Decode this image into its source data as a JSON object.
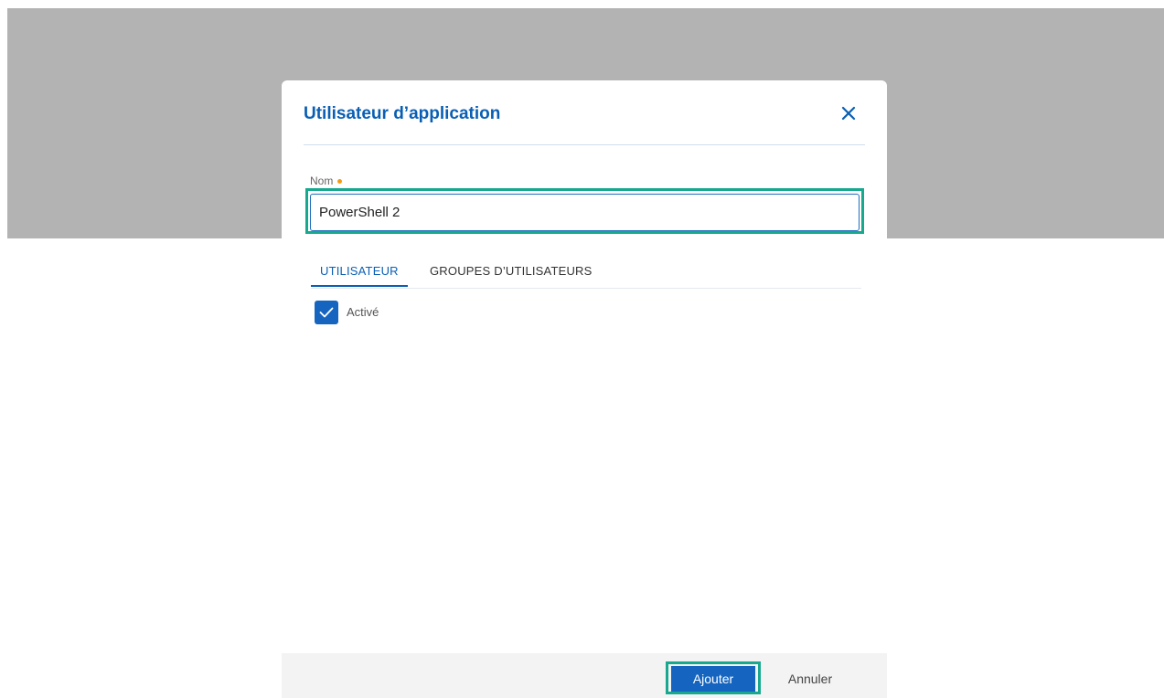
{
  "dialog": {
    "title": "Utilisateur d’application",
    "close_icon": "close-icon"
  },
  "form": {
    "name_label": "Nom",
    "name_value": "PowerShell 2"
  },
  "tabs": [
    {
      "label": "UTILISATEUR",
      "active": true
    },
    {
      "label": "GROUPES D’UTILISATEURS",
      "active": false
    }
  ],
  "user_tab": {
    "enabled_label": "Activé",
    "enabled_checked": true
  },
  "footer": {
    "add_label": "Ajouter",
    "cancel_label": "Annuler"
  },
  "colors": {
    "accent": "#0a5fb4",
    "primary_button": "#1565c0",
    "highlight": "#17a88e",
    "required_dot": "#f39c12",
    "backdrop": "#b3b3b3"
  }
}
